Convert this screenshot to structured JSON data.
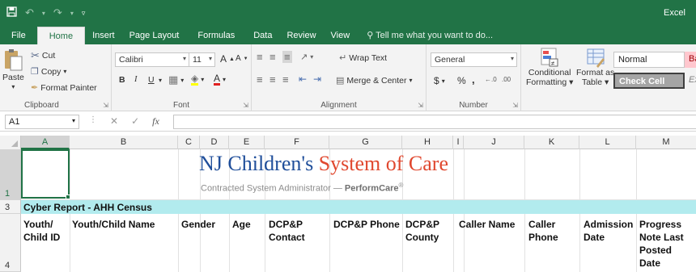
{
  "window": {
    "title": "Excel"
  },
  "colors": {
    "brand": "#217346",
    "accent_band": "#b2ebee",
    "logo_blue": "#1f4e9a",
    "logo_red": "#e0482f"
  },
  "tabs": [
    "File",
    "Home",
    "Insert",
    "Page Layout",
    "Formulas",
    "Data",
    "Review",
    "View"
  ],
  "tell_me": "Tell me what you want to do...",
  "ribbon": {
    "clipboard": {
      "label": "Clipboard",
      "paste": "Paste",
      "cut": "Cut",
      "copy": "Copy",
      "format_painter": "Format Painter"
    },
    "font": {
      "label": "Font",
      "name": "Calibri",
      "size": "11",
      "bold": "B",
      "italic": "I",
      "underline": "U"
    },
    "alignment": {
      "label": "Alignment",
      "wrap": "Wrap Text",
      "merge": "Merge & Center"
    },
    "number": {
      "label": "Number",
      "format": "General",
      "currency": "$",
      "percent": "%",
      "comma": ","
    },
    "styles": {
      "conditional": "Conditional",
      "conditional2": "Formatting",
      "format_as": "Format as",
      "format_as2": "Table",
      "normal": "Normal",
      "check_cell": "Check Cell",
      "bad": "Ba",
      "explanatory": "Ex"
    }
  },
  "formula_bar": {
    "name_box": "A1",
    "fx": "fx",
    "value": ""
  },
  "columns": [
    "A",
    "B",
    "C",
    "D",
    "E",
    "F",
    "G",
    "H",
    "I",
    "J",
    "K",
    "L",
    "M"
  ],
  "rows": [
    "1",
    "3",
    "4"
  ],
  "logo": {
    "main": "NJ Children's ",
    "accent": "System of Care",
    "sub": "Contracted System Administrator — ",
    "sub_bold": "PerformCare",
    "reg": "®"
  },
  "sheet": {
    "band_title": "Cyber Report - AHH Census",
    "headers": [
      "Youth/ Child ID",
      "Youth/Child Name",
      "Gender",
      "Age",
      "DCP&P Contact",
      "DCP&P Phone",
      "DCP&P County",
      "Caller Name",
      "Caller Phone",
      "Admission Date",
      "Progress Note Last Posted Date"
    ]
  }
}
